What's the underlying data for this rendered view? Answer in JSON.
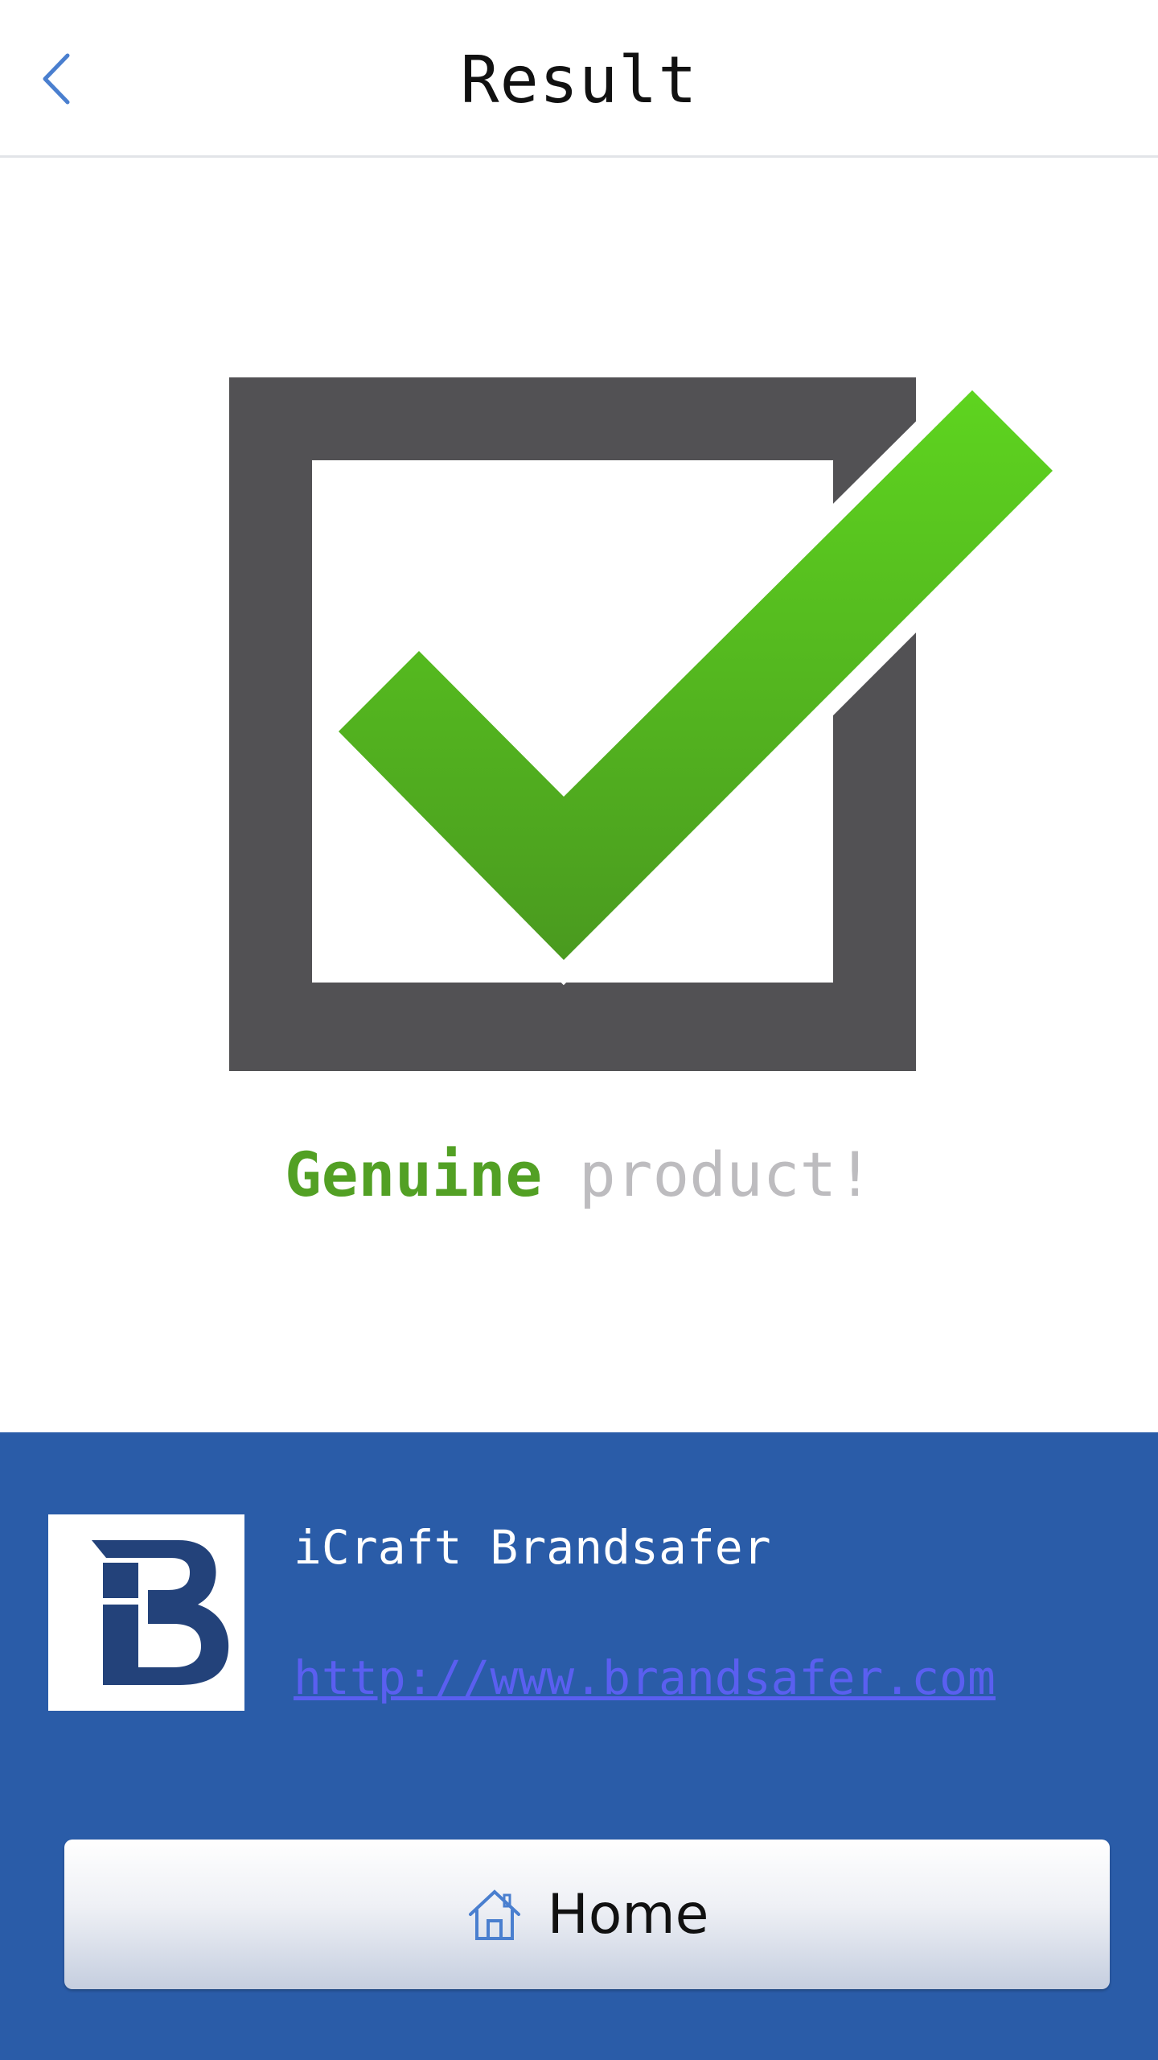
{
  "header": {
    "back_icon": "chevron-left-icon",
    "title": "Result"
  },
  "result": {
    "icon": "checkbox-checked-icon",
    "status_word": "Genuine",
    "status_rest": "product!",
    "colors": {
      "box": "#525154",
      "check_top": "#5ed41f",
      "check_bottom": "#4a9a1f",
      "status_word": "#52a024",
      "status_rest": "#bdbcbf"
    }
  },
  "footer": {
    "background": "#2a5ca8",
    "brand_logo": "brandsafer-logo",
    "brand_name": "iCraft Brandsafer",
    "brand_url": "http://www.brandsafer.com",
    "home_button": {
      "icon": "home-icon",
      "label": "Home"
    }
  }
}
